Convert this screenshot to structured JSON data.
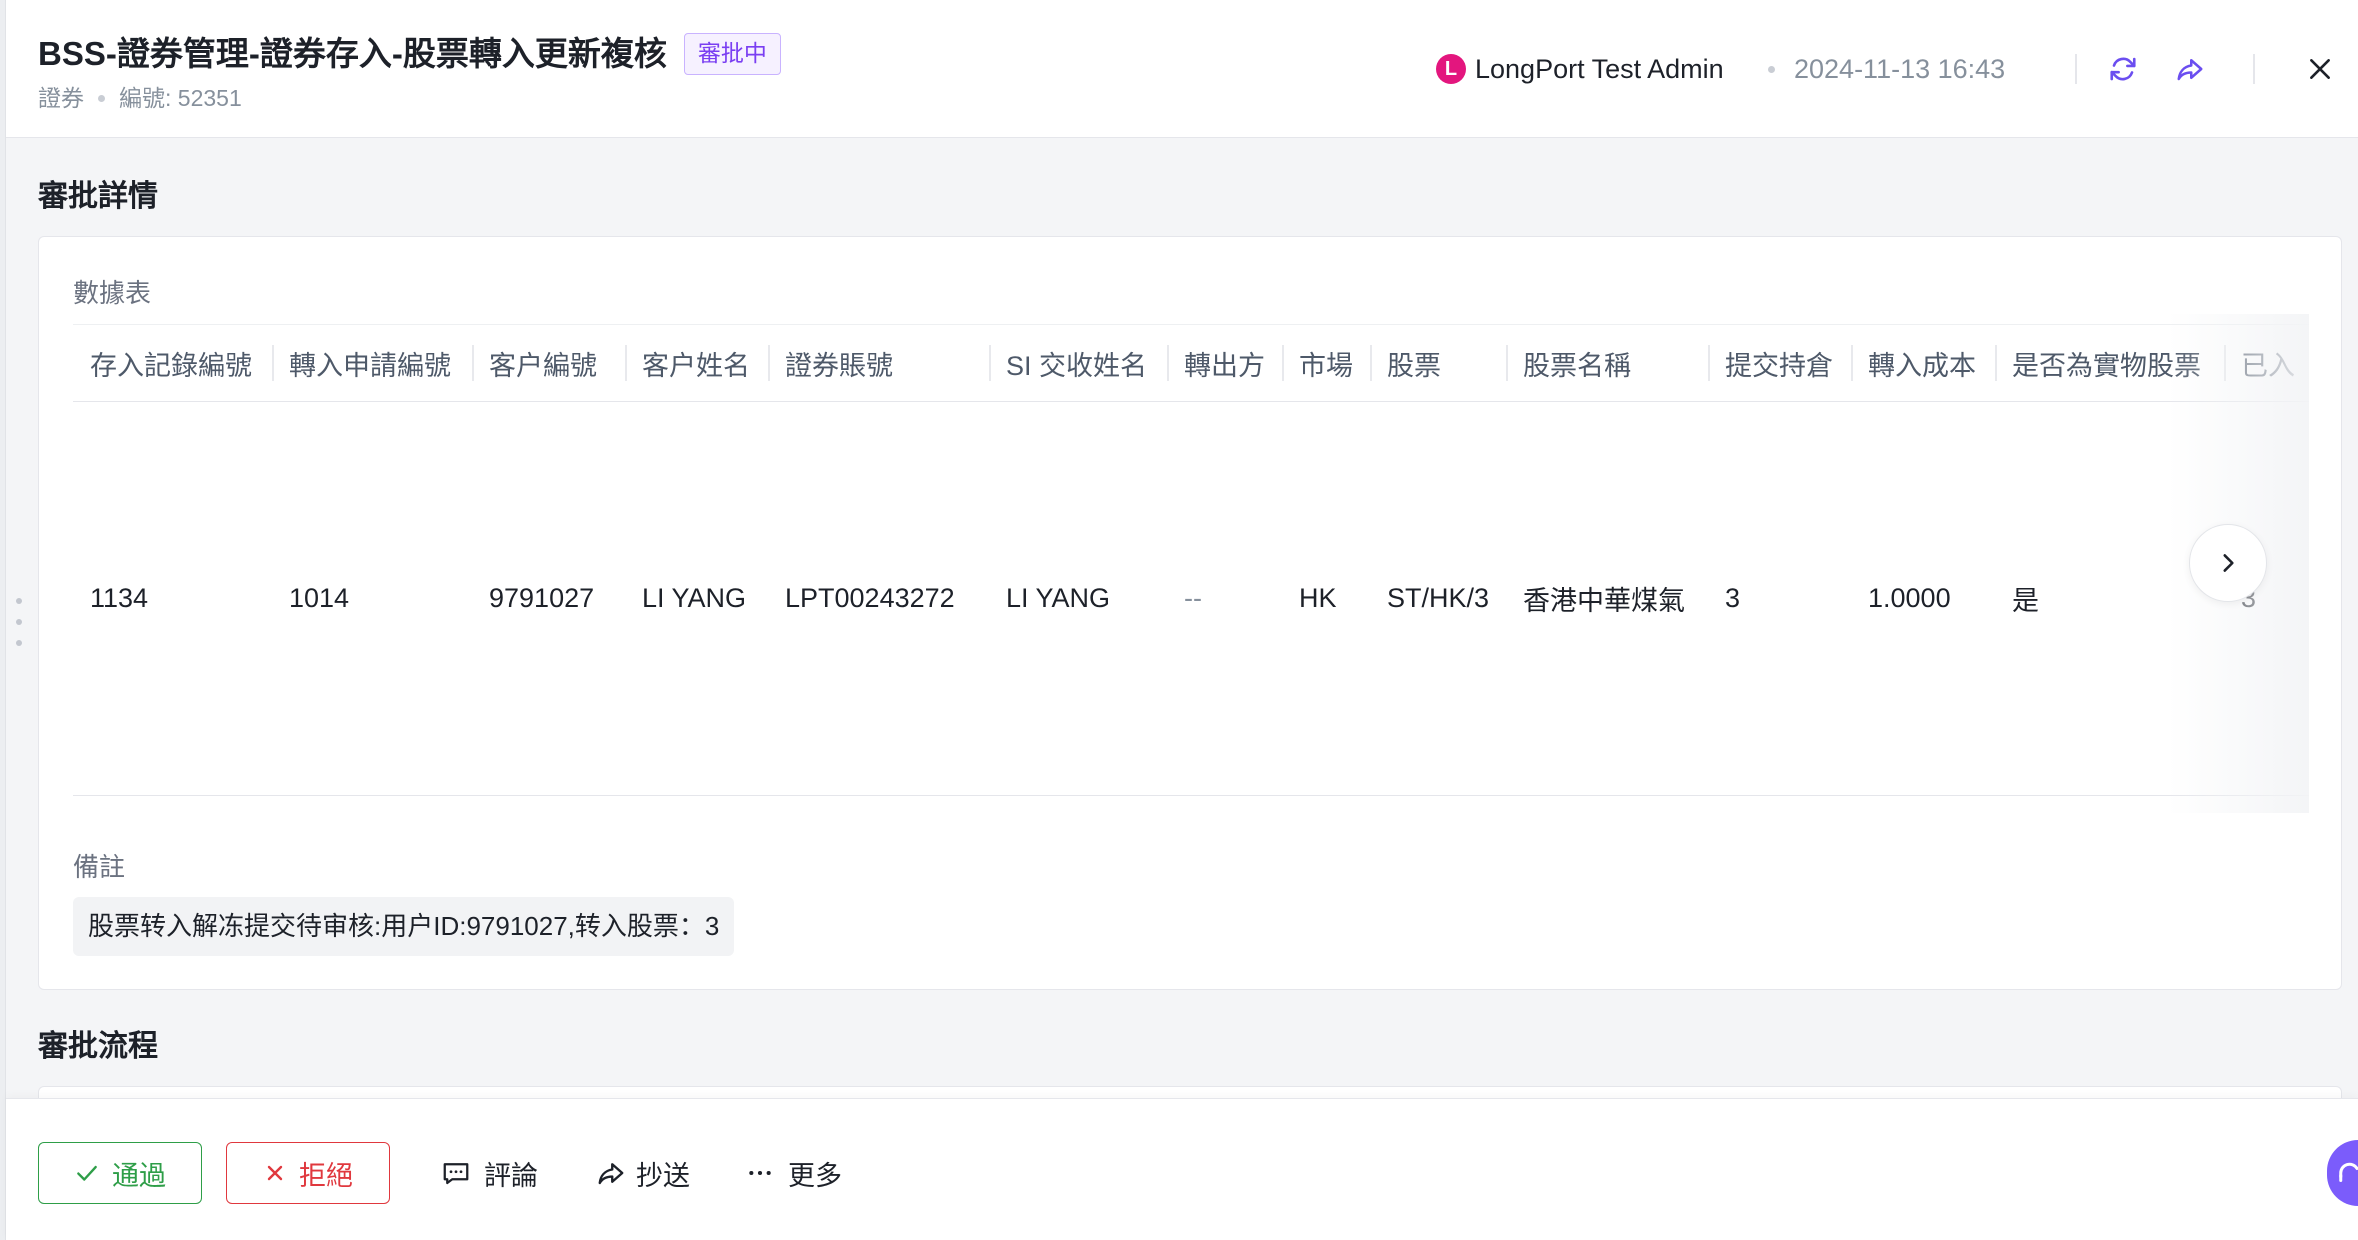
{
  "header": {
    "title": "BSS-證券管理-證券存入-股票轉入更新複核",
    "status_badge": "審批中",
    "category": "證券",
    "serial": "編號: 52351",
    "user": {
      "avatar_letter": "L",
      "name": "LongPort Test Admin"
    },
    "timestamp": "2024-11-13 16:43"
  },
  "details": {
    "section_title": "審批詳情",
    "table_label": "數據表",
    "table": {
      "columns": [
        "存入記錄編號",
        "轉入申請編號",
        "客户編號",
        "客户姓名",
        "證券賬號",
        "SI 交收姓名",
        "轉出方",
        "市場",
        "股票",
        "股票名稱",
        "提交持倉",
        "轉入成本",
        "是否為實物股票",
        "已入"
      ],
      "rows": [
        [
          "1134",
          "1014",
          "9791027",
          "LI YANG",
          "LPT00243272",
          "LI YANG",
          "--",
          "HK",
          "ST/HK/3",
          "香港中華煤氣",
          "3",
          "1.0000",
          "是",
          "3"
        ]
      ]
    },
    "remark_label": "備註",
    "remark_text": "股票转入解冻提交待审核:用户ID:9791027,转入股票：3"
  },
  "process": {
    "section_title": "審批流程"
  },
  "footer": {
    "approve_label": "通過",
    "reject_label": "拒絕",
    "comment_label": "評論",
    "cc_label": "抄送",
    "more_label": "更多"
  },
  "icons": {
    "refresh": "refresh-icon",
    "share": "share-icon",
    "close": "close-icon",
    "scroll_right": "chevron-right-icon",
    "approve": "check-icon",
    "reject": "x-icon",
    "comment": "comment-icon",
    "cc": "forward-icon",
    "more": "ellipsis-icon",
    "help": "headset-icon"
  },
  "colors": {
    "accent": "#6b4ef0",
    "badge_text": "#7a3ff2",
    "badge_border": "#c9b3ff",
    "badge_bg": "#f6f1ff",
    "approve": "#2e9e48",
    "reject": "#e0383e",
    "avatar": "#e3167e",
    "help_button": "#7b5cfb"
  }
}
